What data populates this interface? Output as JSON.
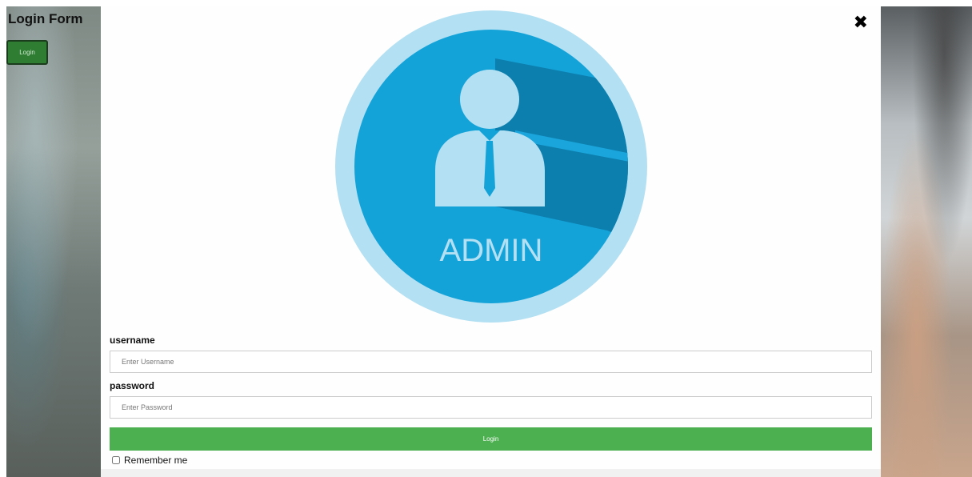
{
  "background": {
    "title": "Login Form",
    "login_button": "Login"
  },
  "modal": {
    "close_glyph": "✖",
    "avatar": {
      "text": "ADMIN",
      "icon": "admin-user-icon",
      "colors": {
        "outer_ring": "#b3e0f2",
        "inner_circle": "#14a3d9",
        "shadow": "#0c7fae",
        "figure": "#b3e0f2"
      }
    },
    "form": {
      "username_label": "username",
      "username_placeholder": "Enter Username",
      "username_value": "",
      "password_label": "password",
      "password_placeholder": "Enter Password",
      "password_value": "",
      "submit_label": "Login",
      "remember_label": "Remember me",
      "remember_checked": false
    }
  },
  "colors": {
    "primary_green": "#4caf50",
    "dark_green_button": "#2e7d32"
  }
}
